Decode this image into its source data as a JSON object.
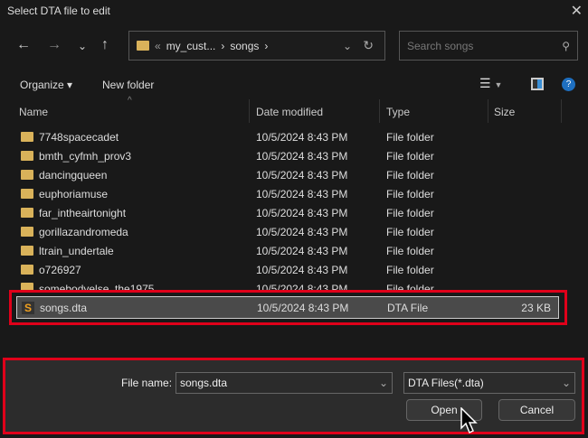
{
  "window": {
    "title": "Select DTA file to edit"
  },
  "address": {
    "overflow": "«",
    "segments": [
      "my_cust...",
      "songs"
    ],
    "separator": "›"
  },
  "search": {
    "placeholder": "Search songs"
  },
  "toolbar": {
    "organize": "Organize ▾",
    "new_folder": "New folder"
  },
  "columns": [
    "Name",
    "Date modified",
    "Type",
    "Size"
  ],
  "rows": [
    {
      "name": "7748spacecadet",
      "date": "10/5/2024 8:43 PM",
      "type": "File folder",
      "size": ""
    },
    {
      "name": "bmth_cyfmh_prov3",
      "date": "10/5/2024 8:43 PM",
      "type": "File folder",
      "size": ""
    },
    {
      "name": "dancingqueen",
      "date": "10/5/2024 8:43 PM",
      "type": "File folder",
      "size": ""
    },
    {
      "name": "euphoriamuse",
      "date": "10/5/2024 8:43 PM",
      "type": "File folder",
      "size": ""
    },
    {
      "name": "far_intheairtonight",
      "date": "10/5/2024 8:43 PM",
      "type": "File folder",
      "size": ""
    },
    {
      "name": "gorillazandromeda",
      "date": "10/5/2024 8:43 PM",
      "type": "File folder",
      "size": ""
    },
    {
      "name": "ltrain_undertale",
      "date": "10/5/2024 8:43 PM",
      "type": "File folder",
      "size": ""
    },
    {
      "name": "o726927",
      "date": "10/5/2024 8:43 PM",
      "type": "File folder",
      "size": ""
    },
    {
      "name": "somebodyelse_the1975",
      "date": "10/5/2024 8:43 PM",
      "type": "File folder",
      "size": ""
    }
  ],
  "selected": {
    "name": "songs.dta",
    "date": "10/5/2024 8:43 PM",
    "type": "DTA File",
    "size": "23 KB"
  },
  "footer": {
    "file_name_label": "File name:",
    "file_name_value": "songs.dta",
    "filter": "DTA Files(*.dta)",
    "open": "Open",
    "cancel": "Cancel"
  },
  "colors": {
    "highlight": "#e0001a",
    "folder": "#d9b25a"
  }
}
